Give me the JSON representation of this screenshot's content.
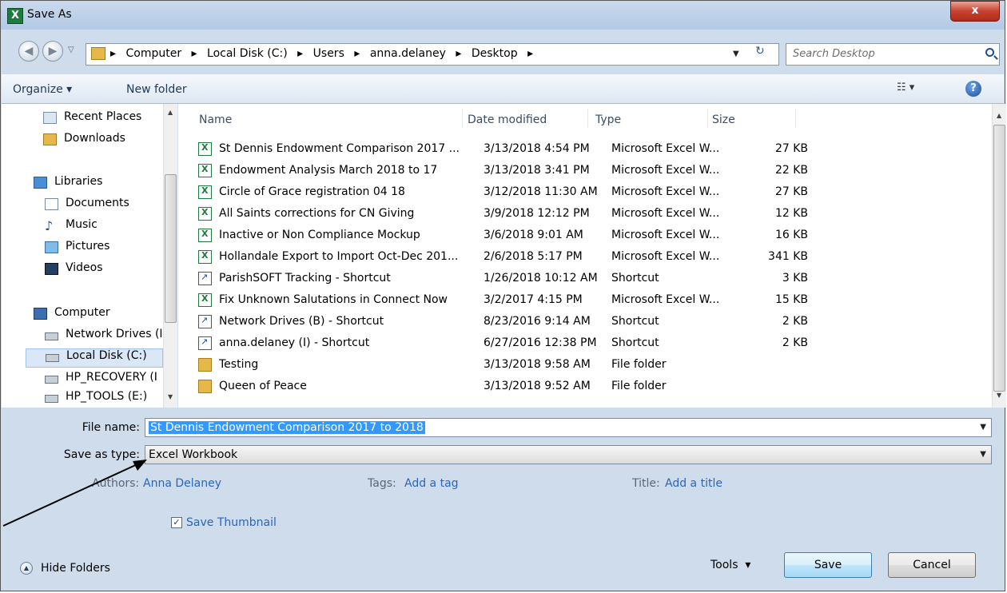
{
  "window": {
    "title": "Save As",
    "close_glyph": "x"
  },
  "address": {
    "crumbs": [
      "Computer",
      "Local Disk (C:)",
      "Users",
      "anna.delaney",
      "Desktop"
    ],
    "search_placeholder": "Search Desktop"
  },
  "toolbar": {
    "organize": "Organize ▾",
    "new_folder": "New folder"
  },
  "nav": {
    "recent_places": "Recent Places",
    "downloads": "Downloads",
    "libraries": "Libraries",
    "documents": "Documents",
    "music": "Music",
    "pictures": "Pictures",
    "videos": "Videos",
    "computer": "Computer",
    "network_drives": "Network Drives (I",
    "local_disk": "Local Disk (C:)",
    "hp_recovery": "HP_RECOVERY (I",
    "hp_tools": "HP_TOOLS (E:)"
  },
  "columns": {
    "name": "Name",
    "date": "Date modified",
    "type": "Type",
    "size": "Size"
  },
  "files": [
    {
      "name": "St Dennis Endowment Comparison 2017 ...",
      "date": "3/13/2018 4:54 PM",
      "type": "Microsoft Excel W...",
      "size": "27 KB",
      "icon": "excel-file-icon"
    },
    {
      "name": "Endowment Analysis March 2018 to 17",
      "date": "3/13/2018 3:41 PM",
      "type": "Microsoft Excel W...",
      "size": "22 KB",
      "icon": "excel-file-icon"
    },
    {
      "name": "Circle of Grace registration 04 18",
      "date": "3/12/2018 11:30 AM",
      "type": "Microsoft Excel W...",
      "size": "27 KB",
      "icon": "excel-file-icon"
    },
    {
      "name": "All Saints corrections for CN Giving",
      "date": "3/9/2018 12:12 PM",
      "type": "Microsoft Excel W...",
      "size": "12 KB",
      "icon": "excel-file-icon"
    },
    {
      "name": "Inactive or Non Compliance Mockup",
      "date": "3/6/2018 9:01 AM",
      "type": "Microsoft Excel W...",
      "size": "16 KB",
      "icon": "excel-file-icon"
    },
    {
      "name": "Hollandale Export to Import Oct-Dec 201...",
      "date": "2/6/2018 5:17 PM",
      "type": "Microsoft Excel W...",
      "size": "341 KB",
      "icon": "excel-file-icon"
    },
    {
      "name": "ParishSOFT Tracking - Shortcut",
      "date": "1/26/2018 10:12 AM",
      "type": "Shortcut",
      "size": "3 KB",
      "icon": "shortcut-icon"
    },
    {
      "name": "Fix Unknown Salutations in Connect Now",
      "date": "3/2/2017 4:15 PM",
      "type": "Microsoft Excel W...",
      "size": "15 KB",
      "icon": "excel-file-icon"
    },
    {
      "name": "Network Drives (B) - Shortcut",
      "date": "8/23/2016 9:14 AM",
      "type": "Shortcut",
      "size": "2 KB",
      "icon": "shortcut-icon"
    },
    {
      "name": "anna.delaney (I) - Shortcut",
      "date": "6/27/2016 12:38 PM",
      "type": "Shortcut",
      "size": "2 KB",
      "icon": "shortcut-icon"
    },
    {
      "name": "Testing",
      "date": "3/13/2018 9:58 AM",
      "type": "File folder",
      "size": "",
      "icon": "folder-icon"
    },
    {
      "name": "Queen of Peace",
      "date": "3/13/2018 9:52 AM",
      "type": "File folder",
      "size": "",
      "icon": "folder-icon"
    }
  ],
  "form": {
    "file_name_label": "File name:",
    "file_name_value": "St Dennis Endowment Comparison 2017 to 2018",
    "save_type_label": "Save as type:",
    "save_type_value": "Excel Workbook",
    "authors_label": "Authors:",
    "authors_value": "Anna Delaney",
    "tags_label": "Tags:",
    "tags_value": "Add a tag",
    "title_label": "Title:",
    "title_value": "Add a title",
    "thumbnail_label": "Save Thumbnail",
    "thumbnail_checked": true
  },
  "footer": {
    "hide_folders": "Hide Folders",
    "tools": "Tools",
    "save": "Save",
    "cancel": "Cancel"
  }
}
